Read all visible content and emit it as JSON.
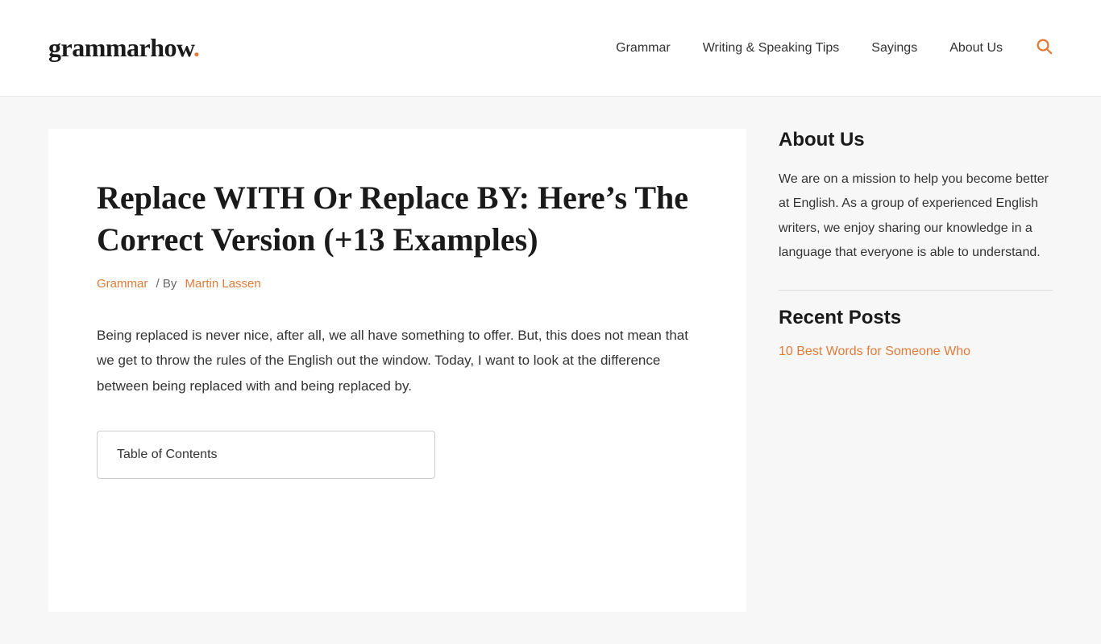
{
  "header": {
    "logo_text": "grammarhow",
    "logo_dot": ".",
    "nav": {
      "items": [
        {
          "label": "Grammar",
          "id": "nav-grammar"
        },
        {
          "label": "Writing & Speaking Tips",
          "id": "nav-writing"
        },
        {
          "label": "Sayings",
          "id": "nav-sayings"
        },
        {
          "label": "About Us",
          "id": "nav-about"
        }
      ]
    }
  },
  "article": {
    "title": "Replace WITH Or Replace BY: Here’s The Correct Version (+13 Examples)",
    "meta": {
      "category": "Grammar",
      "separator": "/ By",
      "author": "Martin Lassen"
    },
    "intro": "Being replaced is never nice, after all, we all have something to offer. But, this does not mean that we get to throw the rules of the English out the window. Today, I want to look at the difference between being replaced with and being replaced by.",
    "toc": {
      "title": "Table of Contents"
    }
  },
  "sidebar": {
    "about": {
      "heading": "About Us",
      "text": "We are on a mission to help you become better at English. As a group of experienced English writers, we enjoy sharing our knowledge in a language that everyone is able to understand."
    },
    "recent_posts": {
      "heading": "Recent Posts",
      "items": [
        {
          "label": "10 Best Words for Someone Who"
        }
      ]
    }
  }
}
